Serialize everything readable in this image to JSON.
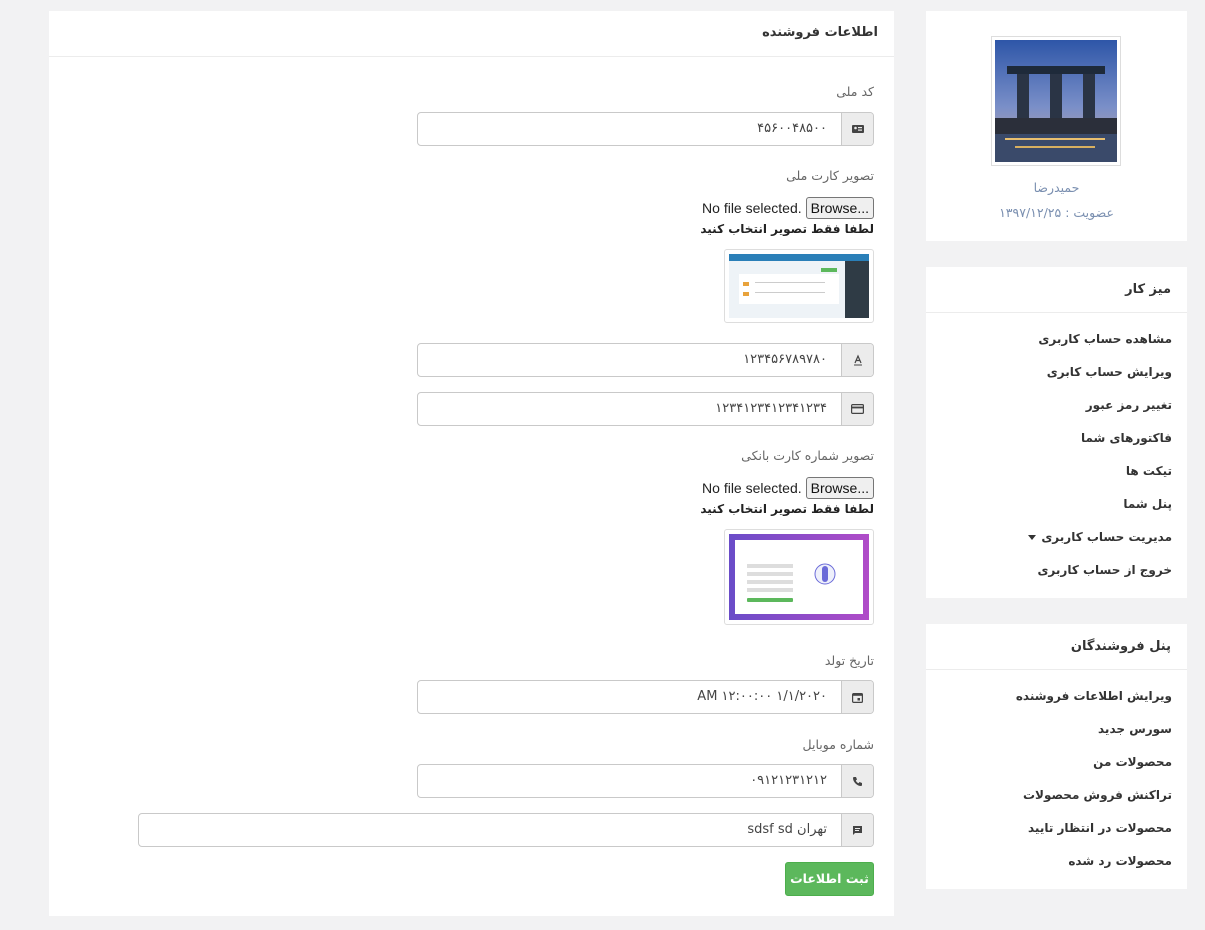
{
  "form": {
    "title": "اطلاعات فروشنده",
    "national_code_label": "کد ملی",
    "national_code_value": "۴۵۶۰۰۴۸۵۰۰",
    "national_card_image_label": "تصویر کارت ملی",
    "file_browse_label": "Browse...",
    "file_none_label": "No file selected.",
    "image_hint": "لطفا فقط تصویر انتخاب کنید",
    "account_number_value": "۱۲۳۴۵۶۷۸۹۷۸۰",
    "card_number_value": "۱۲۳۴۱۲۳۴۱۲۳۴۱۲۳۴",
    "bank_card_image_label": "تصویر شماره کارت بانکی",
    "birth_date_label": "تاریخ تولد",
    "birth_date_value": "۱/۱/۲۰۲۰ ۱۲:۰۰:۰۰ AM",
    "mobile_label": "شماره موبایل",
    "mobile_value": "۰۹۱۲۱۲۳۱۲۱۲",
    "address_value": "تهران sdsf sd",
    "submit_label": "ثبت اطلاعات"
  },
  "profile": {
    "name": "حمیدرضا",
    "membership": "عضویت : ۱۳۹۷/۱۲/۲۵"
  },
  "desk": {
    "title": "میز کار",
    "items": [
      "مشاهده حساب کاربری",
      "ویرایش حساب کابری",
      "تغییر رمز عبور",
      "فاکتورهای شما",
      "تیکت ها",
      "پنل شما",
      "مدیریت حساب کاربری",
      "خروج از حساب کاربری"
    ]
  },
  "sellers": {
    "title": "پنل فروشندگان",
    "items": [
      "ویرایش اطلاعات فروشنده",
      "سورس جدید",
      "محصولات من",
      "تراکنش فروش محصولات",
      "محصولات در انتظار تایید",
      "محصولات رد شده"
    ]
  },
  "colors": {
    "accent": "#5cb85c",
    "muted_link": "#7a8fb0",
    "background": "#f2f2f3"
  }
}
